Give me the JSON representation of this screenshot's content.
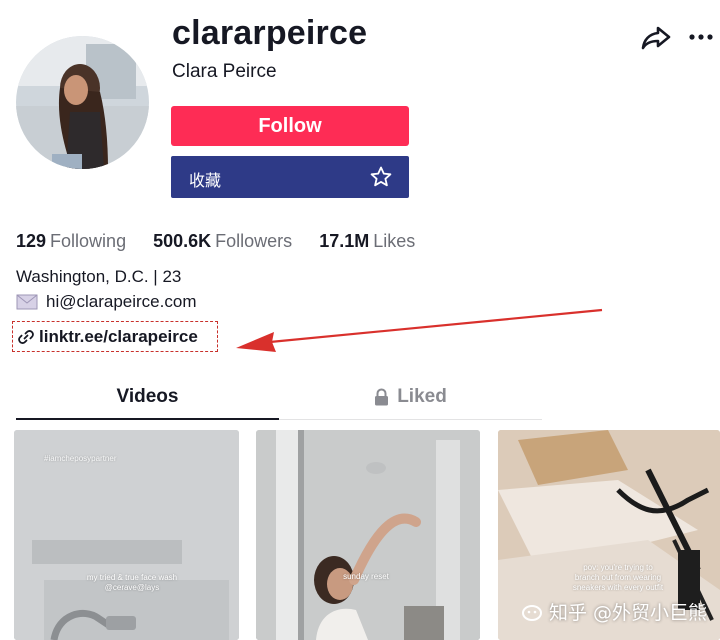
{
  "profile": {
    "username": "clararpeirce",
    "display_name": "Clara Peirce"
  },
  "actions": {
    "follow_label": "Follow",
    "favorite_label": "收藏"
  },
  "stats": [
    {
      "value": "129",
      "label": "Following"
    },
    {
      "value": "500.6K",
      "label": "Followers"
    },
    {
      "value": "17.1M",
      "label": "Likes"
    }
  ],
  "bio": {
    "location": "Washington, D.C. | 23",
    "email": "hi@clarapeirce.com",
    "link": "linktr.ee/clarapeirce"
  },
  "tabs": [
    {
      "label": "Videos",
      "active": true
    },
    {
      "label": "Liked",
      "active": false,
      "locked": true
    }
  ],
  "videos": [
    {
      "overlay_top": "#iamcheposypartner",
      "caption": "my tried & true face wash @cerave@lays"
    },
    {
      "caption": "sunday reset"
    },
    {
      "caption": "pov: you're trying to branch out from wearing sneakers with every outfit"
    }
  ],
  "watermark": {
    "text": "知乎 @外贸小巨熊"
  },
  "colors": {
    "follow": "#fe2c55",
    "favorite": "#2e3a87",
    "annotation": "#d9302c",
    "text_primary": "#161823",
    "text_secondary": "#6b6d75"
  },
  "icons": [
    "share-icon",
    "more-icon",
    "star-icon",
    "mail-icon",
    "link-icon",
    "lock-icon"
  ]
}
